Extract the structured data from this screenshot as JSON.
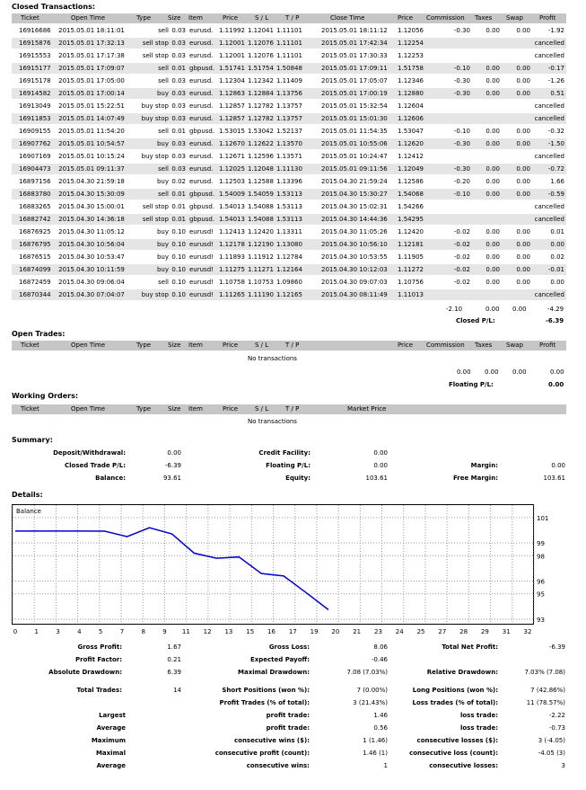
{
  "closed": {
    "title": "Closed Transactions:",
    "headers": [
      "Ticket",
      "Open Time",
      "Type",
      "Size",
      "Item",
      "Price",
      "S / L",
      "T / P",
      "Close Time",
      "Price",
      "Commission",
      "Taxes",
      "Swap",
      "Profit"
    ],
    "rows": [
      [
        "16916686",
        "2015.05.01 18:11:01",
        "sell",
        "0.03",
        "eurusd.",
        "1.11992",
        "1.12041",
        "1.11101",
        "2015.05.01 18:11:12",
        "1.12056",
        "-0.30",
        "0.00",
        "0.00",
        "-1.92"
      ],
      [
        "16915876",
        "2015.05.01 17:32:13",
        "sell stop",
        "0.03",
        "eurusd.",
        "1.12001",
        "1.12076",
        "1.11101",
        "2015.05.01 17:42:34",
        "1.12254",
        "",
        "",
        "",
        "cancelled"
      ],
      [
        "16915553",
        "2015.05.01 17:17:38",
        "sell stop",
        "0.03",
        "eurusd.",
        "1.12001",
        "1.12076",
        "1.11101",
        "2015.05.01 17:30:33",
        "1.12253",
        "",
        "",
        "",
        "cancelled"
      ],
      [
        "16915177",
        "2015.05.01 17:09:07",
        "sell",
        "0.01",
        "gbpusd.",
        "1.51741",
        "1.51754",
        "1.50848",
        "2015.05.01 17:09:11",
        "1.51758",
        "-0.10",
        "0.00",
        "0.00",
        "-0.17"
      ],
      [
        "16915178",
        "2015.05.01 17:05:00",
        "sell",
        "0.03",
        "eurusd.",
        "1.12304",
        "1.12342",
        "1.11409",
        "2015.05.01 17:05:07",
        "1.12346",
        "-0.30",
        "0.00",
        "0.00",
        "-1.26"
      ],
      [
        "16914582",
        "2015.05.01 17:00:14",
        "buy",
        "0.03",
        "eurusd.",
        "1.12863",
        "1.12884",
        "1.13756",
        "2015.05.01 17:00:19",
        "1.12880",
        "-0.30",
        "0.00",
        "0.00",
        "0.51"
      ],
      [
        "16913049",
        "2015.05.01 15:22:51",
        "buy stop",
        "0.03",
        "eurusd.",
        "1.12857",
        "1.12782",
        "1.13757",
        "2015.05.01 15:32:54",
        "1.12604",
        "",
        "",
        "",
        "cancelled"
      ],
      [
        "16911853",
        "2015.05.01 14:07:49",
        "buy stop",
        "0.03",
        "eurusd.",
        "1.12857",
        "1.12782",
        "1.13757",
        "2015.05.01 15:01:30",
        "1.12606",
        "",
        "",
        "",
        "cancelled"
      ],
      [
        "16909155",
        "2015.05.01 11:54:20",
        "sell",
        "0.01",
        "gbpusd.",
        "1.53015",
        "1.53042",
        "1.52137",
        "2015.05.01 11:54:35",
        "1.53047",
        "-0.10",
        "0.00",
        "0.00",
        "-0.32"
      ],
      [
        "16907762",
        "2015.05.01 10:54:57",
        "buy",
        "0.03",
        "eurusd.",
        "1.12670",
        "1.12622",
        "1.13570",
        "2015.05.01 10:55:06",
        "1.12620",
        "-0.30",
        "0.00",
        "0.00",
        "-1.50"
      ],
      [
        "16907169",
        "2015.05.01 10:15:24",
        "buy stop",
        "0.03",
        "eurusd.",
        "1.12671",
        "1.12596",
        "1.13571",
        "2015.05.01 10:24:47",
        "1.12412",
        "",
        "",
        "",
        "cancelled"
      ],
      [
        "16904473",
        "2015.05.01 09:11:37",
        "sell",
        "0.03",
        "eurusd.",
        "1.12025",
        "1.12048",
        "1.11130",
        "2015.05.01 09:11:56",
        "1.12049",
        "-0.30",
        "0.00",
        "0.00",
        "-0.72"
      ],
      [
        "16897156",
        "2015.04.30 21:59:18",
        "buy",
        "0.02",
        "eurusd.",
        "1.12503",
        "1.12588",
        "1.13396",
        "2015.04.30 21:59:24",
        "1.12586",
        "-0.20",
        "0.00",
        "0.00",
        "1.66"
      ],
      [
        "16883780",
        "2015.04.30 15:30:09",
        "sell",
        "0.01",
        "gbpusd.",
        "1.54009",
        "1.54059",
        "1.53113",
        "2015.04.30 15:30:27",
        "1.54068",
        "-0.10",
        "0.00",
        "0.00",
        "-0.59"
      ],
      [
        "16883265",
        "2015.04.30 15:00:01",
        "sell stop",
        "0.01",
        "gbpusd.",
        "1.54013",
        "1.54088",
        "1.53113",
        "2015.04.30 15:02:31",
        "1.54266",
        "",
        "",
        "",
        "cancelled"
      ],
      [
        "16882742",
        "2015.04.30 14:36:18",
        "sell stop",
        "0.01",
        "gbpusd.",
        "1.54013",
        "1.54088",
        "1.53113",
        "2015.04.30 14:44:36",
        "1.54295",
        "",
        "",
        "",
        "cancelled"
      ],
      [
        "16876925",
        "2015.04.30 11:05:12",
        "buy",
        "0.10",
        "eurusd!",
        "1.12413",
        "1.12420",
        "1.13311",
        "2015.04.30 11:05:26",
        "1.12420",
        "-0.02",
        "0.00",
        "0.00",
        "0.01"
      ],
      [
        "16876795",
        "2015.04.30 10:56:04",
        "buy",
        "0.10",
        "eurusd!",
        "1.12178",
        "1.12190",
        "1.13080",
        "2015.04.30 10:56:10",
        "1.12181",
        "-0.02",
        "0.00",
        "0.00",
        "0.00"
      ],
      [
        "16876515",
        "2015.04.30 10:53:47",
        "buy",
        "0.10",
        "eurusd!",
        "1.11893",
        "1.11912",
        "1.12784",
        "2015.04.30 10:53:55",
        "1.11905",
        "-0.02",
        "0.00",
        "0.00",
        "0.02"
      ],
      [
        "16874099",
        "2015.04.30 10:11:59",
        "buy",
        "0.10",
        "eurusd!",
        "1.11275",
        "1.11271",
        "1.12164",
        "2015.04.30 10:12:03",
        "1.11272",
        "-0.02",
        "0.00",
        "0.00",
        "-0.01"
      ],
      [
        "16872459",
        "2015.04.30 09:06:04",
        "sell",
        "0.10",
        "eurusd!",
        "1.10758",
        "1.10753",
        "1.09860",
        "2015.04.30 09:07:03",
        "1.10756",
        "-0.02",
        "0.00",
        "0.00",
        "0.00"
      ],
      [
        "16870344",
        "2015.04.30 07:04:07",
        "buy stop",
        "0.10",
        "eurusd!",
        "1.11265",
        "1.11190",
        "1.12165",
        "2015.04.30 08:11:49",
        "1.11013",
        "",
        "",
        "",
        "cancelled"
      ]
    ],
    "totals": {
      "commission": "-2.10",
      "taxes": "0.00",
      "swap": "0.00",
      "profit": "-4.29"
    },
    "closed_pl_label": "Closed P/L:",
    "closed_pl_value": "-6.39"
  },
  "open": {
    "title": "Open Trades:",
    "headers": [
      "Ticket",
      "Open Time",
      "Type",
      "Size",
      "Item",
      "Price",
      "S / L",
      "T / P",
      "Price",
      "Commission",
      "Taxes",
      "Swap",
      "Profit"
    ],
    "empty": "No transactions",
    "totals": {
      "commission": "0.00",
      "taxes": "0.00",
      "swap": "0.00",
      "profit": "0.00"
    },
    "floating_label": "Floating P/L:",
    "floating_value": "0.00"
  },
  "working": {
    "title": "Working Orders:",
    "headers": [
      "Ticket",
      "Open Time",
      "Type",
      "Size",
      "Item",
      "Price",
      "S / L",
      "T / P",
      "Market Price"
    ],
    "empty": "No transactions"
  },
  "summary": {
    "title": "Summary:",
    "deposit_label": "Deposit/Withdrawal:",
    "deposit": "0.00",
    "credit_label": "Credit Facility:",
    "credit": "0.00",
    "closed_label": "Closed Trade P/L:",
    "closed": "-6.39",
    "floating_label": "Floating P/L:",
    "floating": "0.00",
    "margin_label": "Margin:",
    "margin": "0.00",
    "balance_label": "Balance:",
    "balance": "93.61",
    "equity_label": "Equity:",
    "equity": "103.61",
    "free_margin_label": "Free Margin:",
    "free_margin": "103.61"
  },
  "details": {
    "title": "Details:"
  },
  "chart_data": {
    "type": "line",
    "title": "Balance",
    "x": [
      0,
      1,
      2,
      3,
      4,
      5,
      6,
      7,
      8,
      9,
      10,
      11,
      12,
      13,
      14
    ],
    "values": [
      99.94,
      99.94,
      99.94,
      99.94,
      99.93,
      99.5,
      100.2,
      99.72,
      98.2,
      97.8,
      97.9,
      96.6,
      96.4,
      95.1,
      93.75
    ],
    "xticks": [
      "0",
      "1",
      "3",
      "4",
      "5",
      "7",
      "8",
      "9",
      "11",
      "12",
      "13",
      "15",
      "16",
      "17",
      "19",
      "20",
      "21",
      "23",
      "24",
      "25",
      "27",
      "28",
      "29",
      "31",
      "32"
    ],
    "yticks": [
      "101",
      "99",
      "98",
      "96",
      "95",
      "93"
    ],
    "ylim": [
      93,
      101.7
    ],
    "line_color": "#0000cc"
  },
  "stats": {
    "gross_profit_label": "Gross Profit:",
    "gross_profit": "1.67",
    "gross_loss_label": "Gross Loss:",
    "gross_loss": "8.06",
    "total_net_label": "Total Net Profit:",
    "total_net": "-6.39",
    "profit_factor_label": "Profit Factor:",
    "profit_factor": "0.21",
    "expected_payoff_label": "Expected Payoff:",
    "expected_payoff": "-0.46",
    "abs_dd_label": "Absolute Drawdown:",
    "abs_dd": "6.39",
    "max_dd_label": "Maximal Drawdown:",
    "max_dd": "7.08 (7.03%)",
    "rel_dd_label": "Relative Drawdown:",
    "rel_dd": "7.03% (7.08)",
    "total_trades_label": "Total Trades:",
    "total_trades": "14",
    "short_label": "Short Positions (won %):",
    "short": "7 (0.00%)",
    "long_label": "Long Positions (won %):",
    "long": "7 (42.86%)",
    "profit_trades_label": "Profit Trades (% of total):",
    "profit_trades": "3 (21.43%)",
    "loss_trades_label": "Loss trades (% of total):",
    "loss_trades": "11 (78.57%)",
    "largest_label": "Largest",
    "largest_profit_label": "profit trade:",
    "largest_profit": "1.46",
    "largest_loss_label": "loss trade:",
    "largest_loss": "-2.22",
    "average_label": "Average",
    "avg_profit_label": "profit trade:",
    "avg_profit": "0.56",
    "avg_loss_label": "loss trade:",
    "avg_loss": "-0.73",
    "maximum_label": "Maximum",
    "max_wins_label": "consecutive wins ($):",
    "max_wins": "1 (1.46)",
    "max_losses_label": "consecutive losses ($):",
    "max_losses": "3 (-4.05)",
    "maximal_label": "Maximal",
    "maximal_profit_label": "consecutive profit (count):",
    "maximal_profit": "1.46 (1)",
    "maximal_loss_label": "consecutive loss (count):",
    "maximal_loss": "-4.05 (3)",
    "average2_label": "Average",
    "avg_wins_label": "consecutive wins:",
    "avg_wins": "1",
    "avg_losses_label": "consecutive losses:",
    "avg_losses": "3"
  }
}
